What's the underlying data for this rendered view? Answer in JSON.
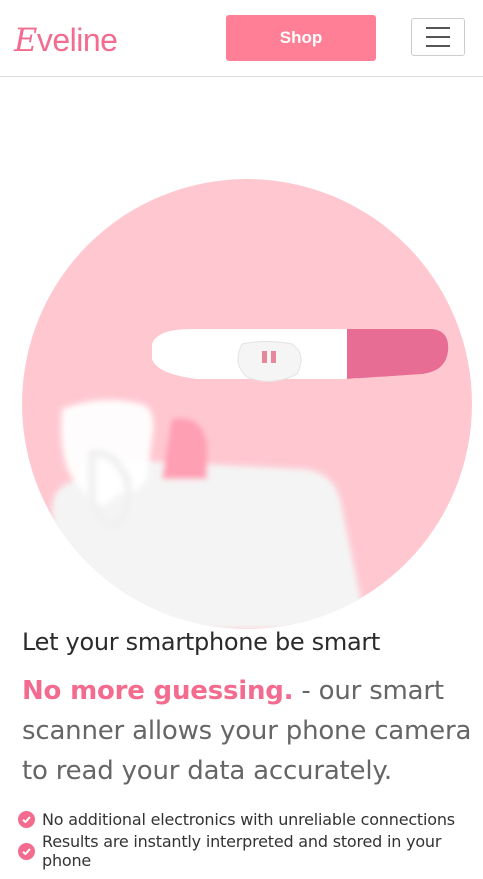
{
  "header": {
    "logo": "Eveline",
    "shop_label": "Shop"
  },
  "icons": {
    "menu": "hamburger-menu-icon",
    "check": "check-circle-icon"
  },
  "colors": {
    "brand": "#f36c8f",
    "shop_button": "#ff7f96",
    "hero_bg": "#ffc8d1",
    "text_dark": "#2b2b2b",
    "text_gray": "#666666"
  },
  "hero": {
    "image": "pregnancy-test-and-smartphone-photo"
  },
  "content": {
    "headline": "Let your smartphone be smart",
    "lead_accent": "No more guessing.",
    "lead_rest": " - our smart scanner allows your phone camera to read your data accurately.",
    "features": [
      "No additional electronics with unreliable connections",
      "Results are instantly interpreted and stored in your phone"
    ]
  }
}
